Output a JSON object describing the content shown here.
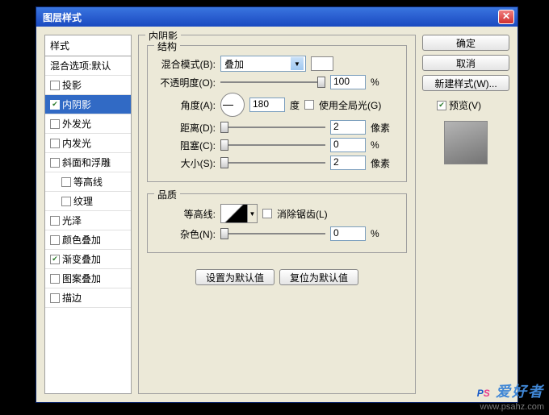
{
  "dialog": {
    "title": "图层样式"
  },
  "left": {
    "header": "样式",
    "blendOptions": "混合选项:默认",
    "items": [
      {
        "label": "投影",
        "checked": false
      },
      {
        "label": "内阴影",
        "checked": true,
        "selected": true
      },
      {
        "label": "外发光",
        "checked": false
      },
      {
        "label": "内发光",
        "checked": false
      },
      {
        "label": "斜面和浮雕",
        "checked": false
      },
      {
        "label": "等高线",
        "checked": false,
        "indent": true
      },
      {
        "label": "纹理",
        "checked": false,
        "indent": true
      },
      {
        "label": "光泽",
        "checked": false
      },
      {
        "label": "颜色叠加",
        "checked": false
      },
      {
        "label": "渐变叠加",
        "checked": true
      },
      {
        "label": "图案叠加",
        "checked": false
      },
      {
        "label": "描边",
        "checked": false
      }
    ]
  },
  "mid": {
    "outerTitle": "内阴影",
    "struct": {
      "title": "结构",
      "blendModeLabel": "混合模式(B):",
      "blendModeValue": "叠加",
      "opacityLabel": "不透明度(O):",
      "opacityValue": "100",
      "opacityUnit": "%",
      "angleLabel": "角度(A):",
      "angleValue": "180",
      "angleUnit": "度",
      "globalLightLabel": "使用全局光(G)",
      "distanceLabel": "距离(D):",
      "distanceValue": "2",
      "distanceUnit": "像素",
      "chokeLabel": "阻塞(C):",
      "chokeValue": "0",
      "chokeUnit": "%",
      "sizeLabel": "大小(S):",
      "sizeValue": "2",
      "sizeUnit": "像素"
    },
    "quality": {
      "title": "品质",
      "contourLabel": "等高线:",
      "antiAliasLabel": "消除锯齿(L)",
      "noiseLabel": "杂色(N):",
      "noiseValue": "0",
      "noiseUnit": "%"
    },
    "setDefault": "设置为默认值",
    "resetDefault": "复位为默认值"
  },
  "right": {
    "ok": "确定",
    "cancel": "取消",
    "newStyle": "新建样式(W)...",
    "previewLabel": "预览(V)"
  },
  "watermark": {
    "url": "www.psahz.com"
  }
}
